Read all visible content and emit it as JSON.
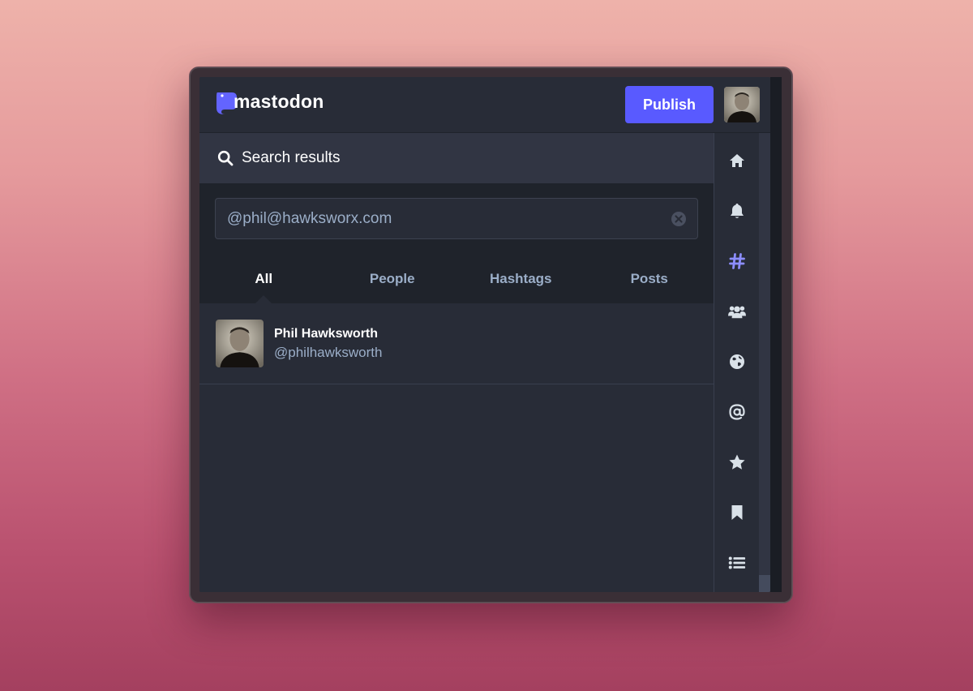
{
  "app": {
    "logo_text": "mastodon",
    "publish_label": "Publish"
  },
  "colors": {
    "accent": "#595aff",
    "background": "#282c37",
    "secondary_text": "#9baec8"
  },
  "column": {
    "title": "Search results",
    "icon": "search-icon"
  },
  "search": {
    "value": "@phil@hawksworx.com"
  },
  "tabs": [
    {
      "label": "All",
      "active": true
    },
    {
      "label": "People",
      "active": false
    },
    {
      "label": "Hashtags",
      "active": false
    },
    {
      "label": "Posts",
      "active": false
    }
  ],
  "results": [
    {
      "display_name": "Phil Hawksworth",
      "handle": "@philhawksworth"
    }
  ],
  "nav": [
    {
      "icon": "home-icon",
      "active": false
    },
    {
      "icon": "bell-icon",
      "active": false
    },
    {
      "icon": "hashtag-icon",
      "active": true
    },
    {
      "icon": "users-icon",
      "active": false
    },
    {
      "icon": "globe-icon",
      "active": false
    },
    {
      "icon": "at-icon",
      "active": false
    },
    {
      "icon": "star-icon",
      "active": false
    },
    {
      "icon": "bookmark-icon",
      "active": false
    },
    {
      "icon": "list-icon",
      "active": false
    }
  ]
}
